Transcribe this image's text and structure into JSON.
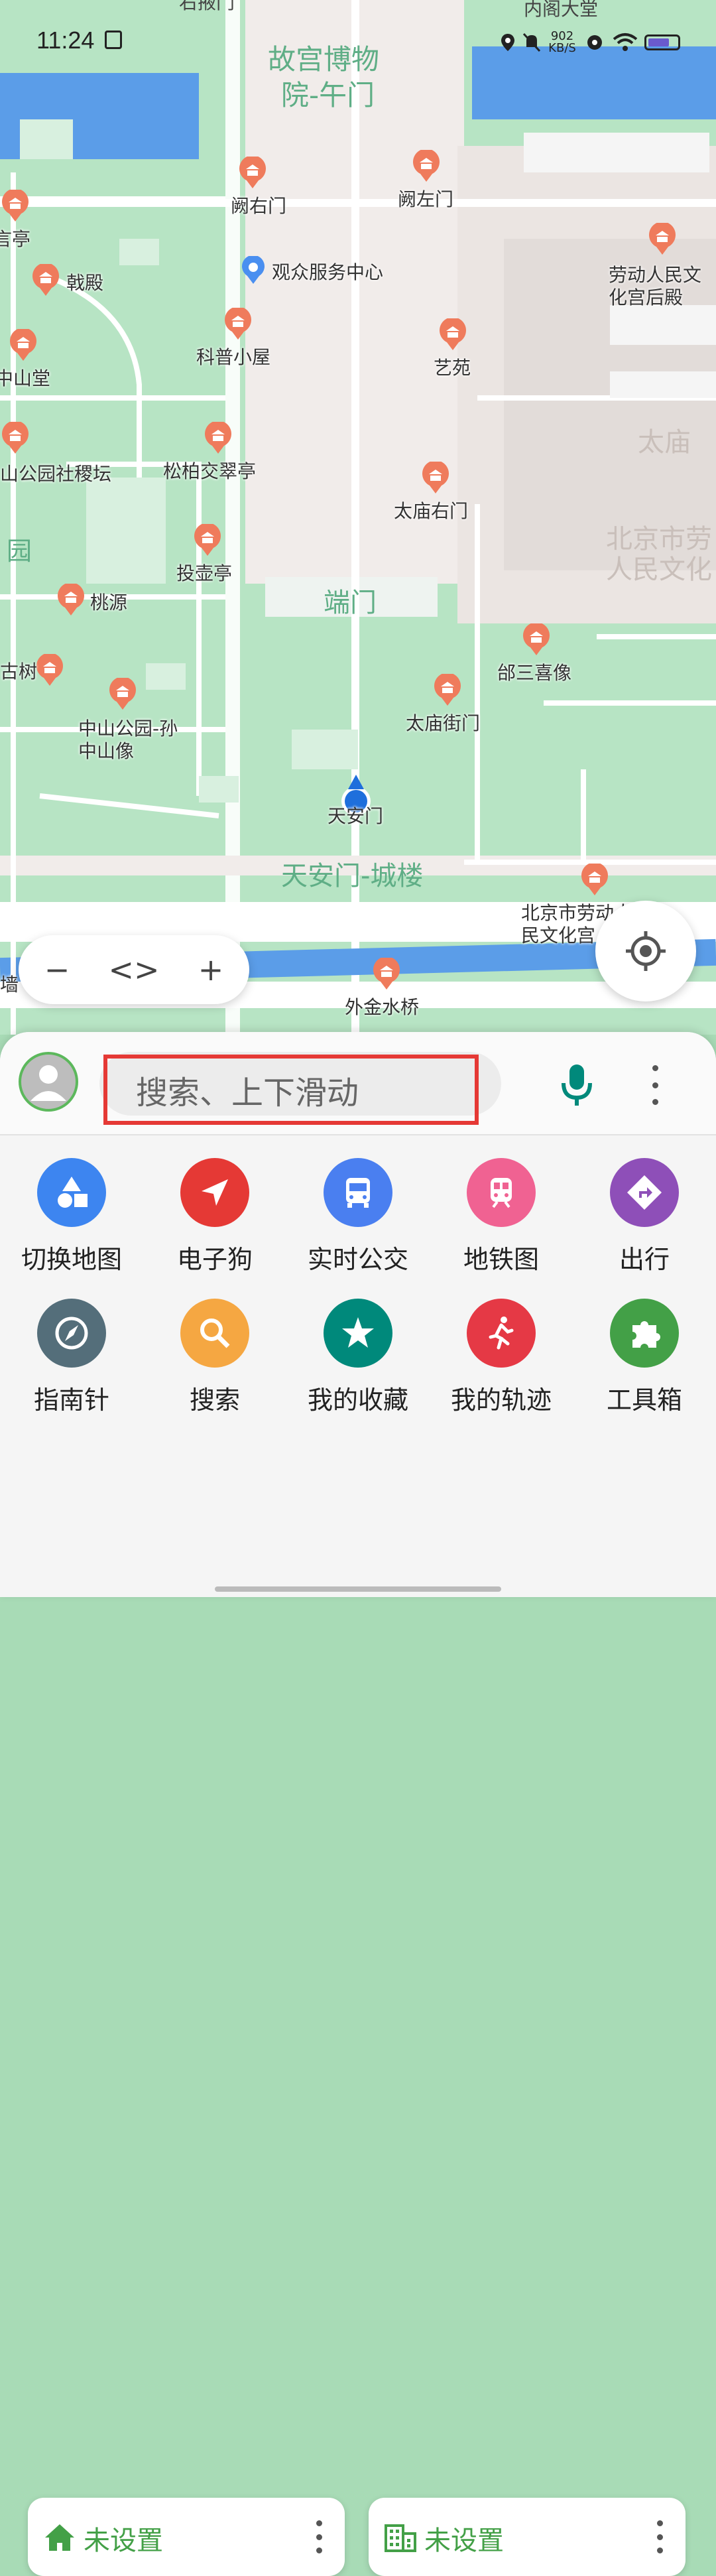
{
  "status_bar": {
    "time": "11:24",
    "net_speed": "902 KB/S"
  },
  "map": {
    "area_labels": [
      {
        "text": "故宫博物",
        "name": "area-label-gugong-1"
      },
      {
        "text": "院-午门",
        "name": "area-label-gugong-2"
      },
      {
        "text": "太庙",
        "name": "area-label-taimiao"
      },
      {
        "text": "北京市劳",
        "name": "area-label-bj-labor-1"
      },
      {
        "text": "人民文化",
        "name": "area-label-bj-labor-2"
      },
      {
        "text": "端门",
        "name": "area-label-duanmen"
      },
      {
        "text": "天安门-城楼",
        "name": "area-label-tiananmen-tower"
      },
      {
        "text": "园",
        "name": "area-label-yuan"
      }
    ],
    "pois": [
      {
        "label": "阙右门"
      },
      {
        "label": "阙左门"
      },
      {
        "label": "劳动人民文化宫后殿"
      },
      {
        "label": "观众服务中心"
      },
      {
        "label": "戟殿"
      },
      {
        "label": "科普小屋"
      },
      {
        "label": "艺苑"
      },
      {
        "label": "中山堂"
      },
      {
        "label": "松柏交翠亭"
      },
      {
        "label": "太庙右门"
      },
      {
        "label": "山公园社稷坛"
      },
      {
        "label": "投壶亭"
      },
      {
        "label": "桃源"
      },
      {
        "label": "邰三喜像"
      },
      {
        "label": "太庙街门"
      },
      {
        "label": "中山公园-孙中山像"
      },
      {
        "label": "天安门"
      },
      {
        "label": "北京市劳动人民文化宫"
      },
      {
        "label": "外金水桥"
      },
      {
        "label": "言亭"
      },
      {
        "label": "古树"
      },
      {
        "label": "墙"
      }
    ],
    "top_partial_labels": {
      "left": "右掖门",
      "right": "内阁大堂"
    }
  },
  "zoom_controls": {
    "zoom_out": "−",
    "toggle": "<>",
    "zoom_in": "+"
  },
  "search": {
    "placeholder": "搜索、上下滑动"
  },
  "quick_actions": [
    {
      "label": "切换地图",
      "icon": "shapes-icon",
      "color": "#3d85f0"
    },
    {
      "label": "电子狗",
      "icon": "navigation-arrow-icon",
      "color": "#e53935"
    },
    {
      "label": "实时公交",
      "icon": "bus-icon",
      "color": "#4a7ff0"
    },
    {
      "label": "地铁图",
      "icon": "subway-icon",
      "color": "#f06292"
    },
    {
      "label": "出行",
      "icon": "directions-icon",
      "color": "#8e4fb8"
    },
    {
      "label": "指南针",
      "icon": "compass-icon",
      "color": "#546e7a"
    },
    {
      "label": "搜索",
      "icon": "search-icon",
      "color": "#f5a742"
    },
    {
      "label": "我的收藏",
      "icon": "star-icon",
      "color": "#00897b"
    },
    {
      "label": "我的轨迹",
      "icon": "runner-icon",
      "color": "#e53945"
    },
    {
      "label": "工具箱",
      "icon": "puzzle-icon",
      "color": "#43a047"
    }
  ],
  "shortcuts": {
    "home": {
      "label": "未设置",
      "icon": "home-icon"
    },
    "work": {
      "label": "未设置",
      "icon": "building-icon"
    }
  }
}
